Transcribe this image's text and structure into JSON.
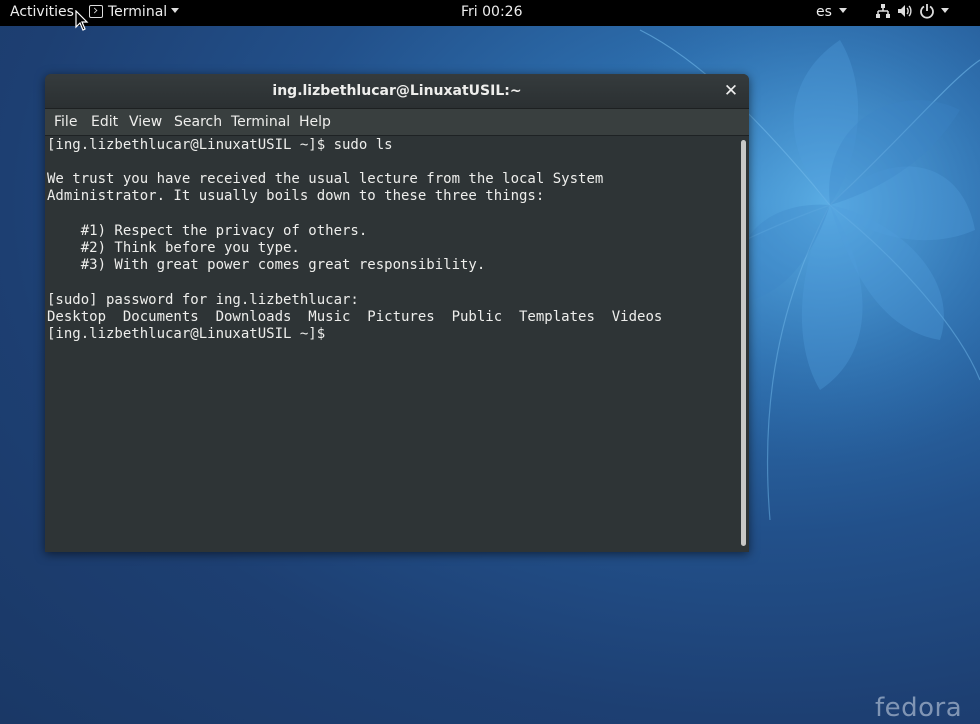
{
  "topbar": {
    "activities": "Activities",
    "app_menu_label": "Terminal",
    "clock": "Fri 00:26",
    "keyboard_layout": "es"
  },
  "window": {
    "title": "ing.lizbethlucar@LinuxatUSIL:~",
    "close_symbol": "✕"
  },
  "menubar": {
    "items": [
      "File",
      "Edit",
      "View",
      "Search",
      "Terminal",
      "Help"
    ]
  },
  "terminal": {
    "lines": [
      "[ing.lizbethlucar@LinuxatUSIL ~]$ sudo ls",
      "",
      "We trust you have received the usual lecture from the local System",
      "Administrator. It usually boils down to these three things:",
      "",
      "    #1) Respect the privacy of others.",
      "    #2) Think before you type.",
      "    #3) With great power comes great responsibility.",
      "",
      "[sudo] password for ing.lizbethlucar:",
      "Desktop  Documents  Downloads  Music  Pictures  Public  Templates  Videos",
      "[ing.lizbethlucar@LinuxatUSIL ~]$ "
    ]
  },
  "wallpaper": {
    "brand": "fedora"
  },
  "icons": {
    "terminal_app": "terminal-icon",
    "network": "network-icon",
    "volume": "volume-icon",
    "power": "power-icon"
  },
  "colors": {
    "topbar_bg": "#000000",
    "terminal_bg": "#2e3436",
    "terminal_fg": "#eeeeec"
  }
}
